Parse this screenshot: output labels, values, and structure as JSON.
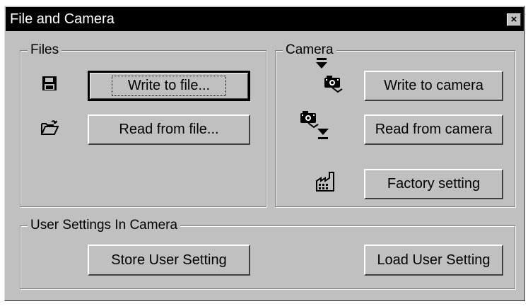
{
  "window": {
    "title": "File and Camera",
    "close_glyph": "×"
  },
  "files": {
    "legend": "Files",
    "write_label": "Write to file...",
    "read_label": "Read from file..."
  },
  "camera": {
    "legend": "Camera",
    "write_label": "Write to camera",
    "read_label": "Read from camera",
    "factory_label": "Factory setting"
  },
  "user_settings": {
    "legend": "User Settings In Camera",
    "store_label": "Store User Setting",
    "load_label": "Load User Setting"
  },
  "icons": {
    "save": "floppy-disk-icon",
    "open": "open-folder-icon",
    "to_camera": "arrow-to-camera-icon",
    "from_camera": "camera-to-arrow-icon",
    "factory": "factory-icon"
  }
}
